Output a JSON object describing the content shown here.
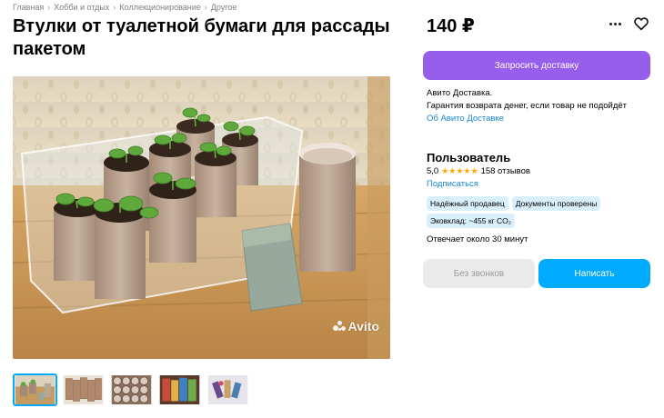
{
  "breadcrumbs": [
    "Главная",
    "Хобби и отдых",
    "Коллекционирование",
    "Другое"
  ],
  "title": "Втулки от туалетной бумаги для рассады пакетом",
  "price": "140 ₽",
  "actions": {
    "delivery_button": "Запросить доставку",
    "no_calls_button": "Без звонков",
    "write_button": "Написать"
  },
  "delivery": {
    "line1": "Авито Доставка.",
    "line2": "Гарантия возврата денег, если товар не подойдёт",
    "link": "Об Авито Доставке"
  },
  "seller": {
    "name": "Пользователь",
    "rating": "5,0",
    "stars": "★★★★★",
    "reviews": "158 отзывов",
    "subscribe": "Подписаться",
    "badges": [
      "Надёжный продавец",
      "Документы проверены",
      "Эковклад: ~455 кг CO₂"
    ],
    "reply_time": "Отвечает около 30 минут"
  },
  "photo": {
    "watermark": "Avito"
  },
  "thumbnails": [
    {
      "name": "thumb-1",
      "active": true
    },
    {
      "name": "thumb-2",
      "active": false
    },
    {
      "name": "thumb-3",
      "active": false
    },
    {
      "name": "thumb-4",
      "active": false
    },
    {
      "name": "thumb-5",
      "active": false
    }
  ],
  "colors": {
    "accent_purple": "#965eeb",
    "accent_blue": "#00aaff",
    "badge_bg": "#d9f0fc",
    "link": "#1a84cf",
    "star": "#ffa800"
  },
  "icons": {
    "more": "more-dots-icon",
    "favorite": "heart-icon"
  }
}
